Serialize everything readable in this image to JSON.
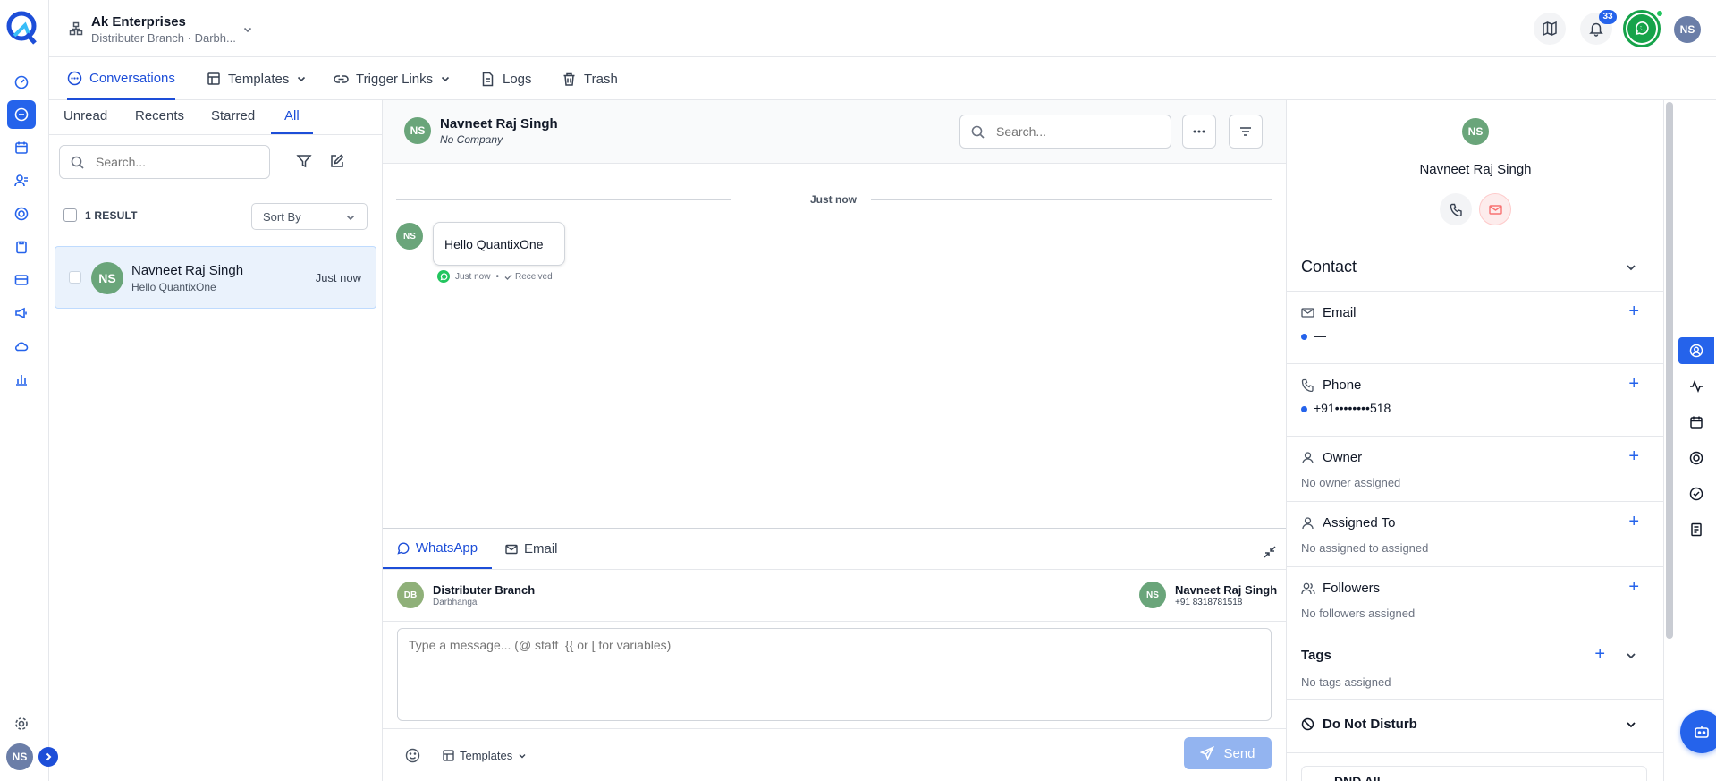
{
  "org": {
    "name": "Ak Enterprises",
    "branch": "Distributer Branch · Darbh..."
  },
  "header": {
    "notifications_count": "33",
    "user_initials": "NS"
  },
  "nav": {
    "conversations": "Conversations",
    "templates": "Templates",
    "trigger_links": "Trigger Links",
    "logs": "Logs",
    "trash": "Trash"
  },
  "filters": {
    "tabs": [
      "Unread",
      "Recents",
      "Starred",
      "All"
    ],
    "active_tab": "All"
  },
  "list": {
    "search_placeholder": "Search...",
    "result_count": "1 RESULT",
    "sort_label": "Sort By",
    "items": [
      {
        "initials": "NS",
        "name": "Navneet Raj Singh",
        "preview": "Hello QuantixOne",
        "time": "Just now"
      }
    ]
  },
  "chat": {
    "contact_initials": "NS",
    "contact_name": "Navneet Raj Singh",
    "company": "No Company",
    "search_placeholder": "Search...",
    "divider_label": "Just now",
    "messages": [
      {
        "initials": "NS",
        "text": "Hello QuantixOne",
        "time": "Just now",
        "status": "Received"
      }
    ]
  },
  "composer": {
    "tabs": [
      "WhatsApp",
      "Email"
    ],
    "from_initials": "DB",
    "from_name": "Distributer Branch",
    "from_sub": "Darbhanga",
    "to_initials": "NS",
    "to_name": "Navneet Raj Singh",
    "to_phone": "+91 8318781518",
    "placeholder": "Type a message... (@ staff  {{ or [ for variables)",
    "templates_label": "Templates",
    "send_label": "Send"
  },
  "contact_panel": {
    "initials": "NS",
    "name": "Navneet Raj Singh",
    "section_title": "Contact",
    "email_label": "Email",
    "email_value": "—",
    "phone_label": "Phone",
    "phone_value": "+91••••••••518",
    "owner_label": "Owner",
    "owner_value": "No owner assigned",
    "assigned_label": "Assigned To",
    "assigned_value": "No assigned to assigned",
    "followers_label": "Followers",
    "followers_value": "No followers assigned",
    "tags_label": "Tags",
    "tags_value": "No tags assigned",
    "dnd_label": "Do Not Disturb",
    "dnd_all_label": "DND All"
  },
  "colors": {
    "primary": "#2563eb",
    "avatar_green": "#6aa57a",
    "whatsapp_green": "#16a34a"
  },
  "icons": {
    "rail": [
      "dashboard-icon",
      "chat-icon",
      "calendar-icon",
      "contacts-icon",
      "target-icon",
      "clipboard-icon",
      "payments-icon",
      "megaphone-icon",
      "cloud-icon",
      "reports-icon",
      "settings-icon"
    ],
    "right_rail": [
      "contact-icon",
      "activity-icon",
      "calendar-icon",
      "target-icon",
      "task-icon",
      "notes-icon"
    ]
  }
}
